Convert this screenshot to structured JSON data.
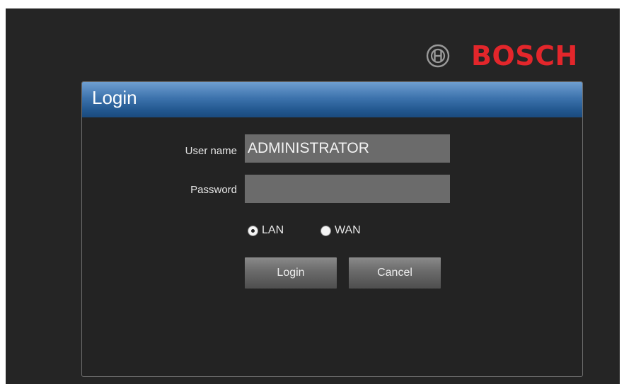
{
  "brand": {
    "name": "BOSCH",
    "logo_icon": "bosch-armature-icon",
    "color": "#e3262b"
  },
  "dialog": {
    "title": "Login",
    "title_bar_color": "#3d73ad"
  },
  "form": {
    "username_label": "User name",
    "username_value": "ADMINISTRATOR",
    "password_label": "Password",
    "password_value": "",
    "network_options": [
      {
        "label": "LAN",
        "selected": true
      },
      {
        "label": "WAN",
        "selected": false
      }
    ],
    "login_button": "Login",
    "cancel_button": "Cancel"
  }
}
